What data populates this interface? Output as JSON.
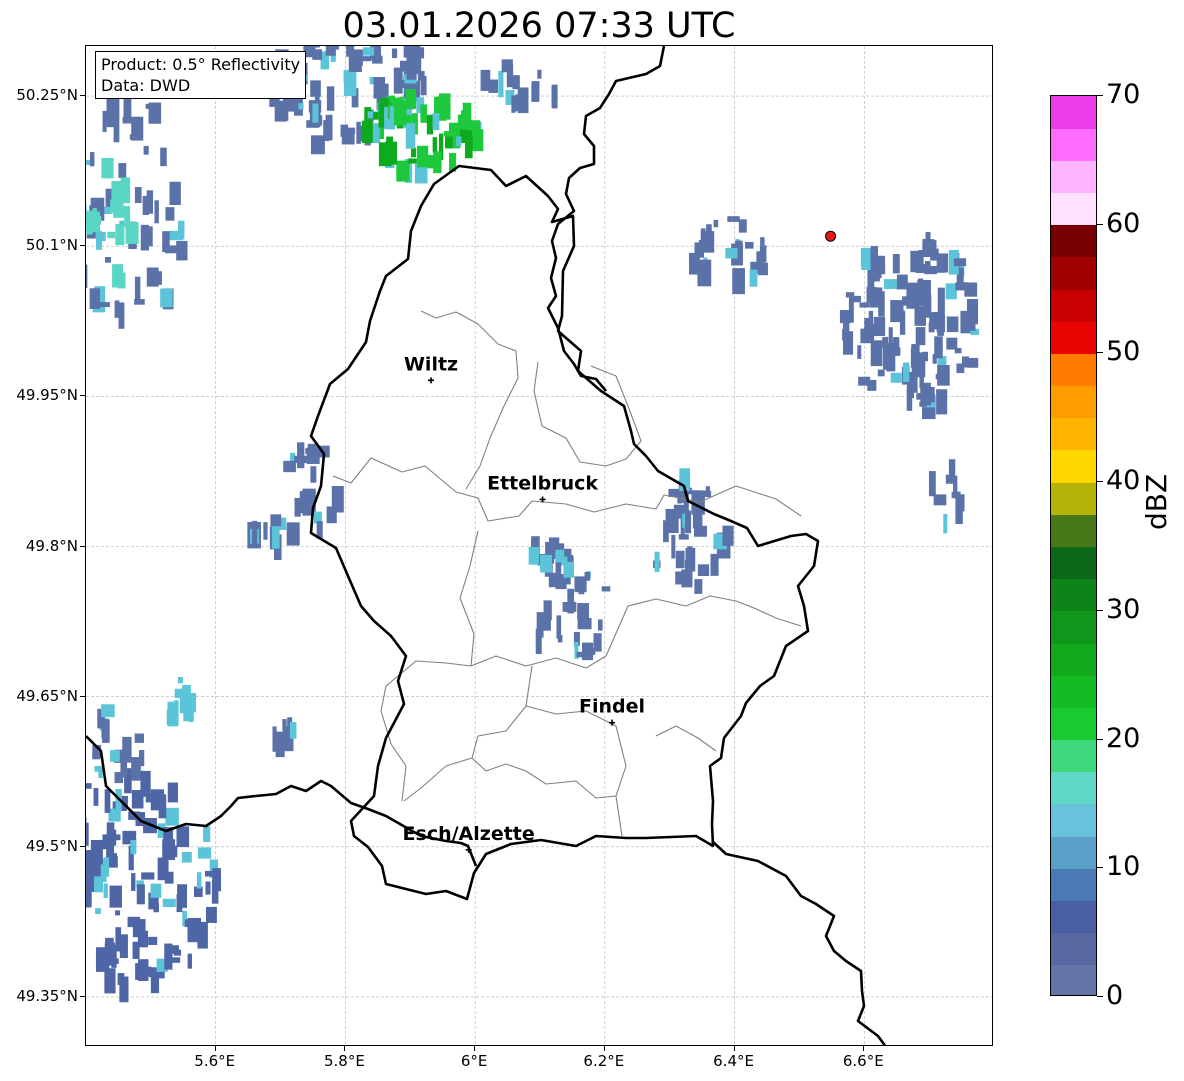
{
  "title": "03.01.2026 07:33 UTC",
  "info": {
    "product": "Product: 0.5° Reflectivity",
    "data_source": "Data: DWD"
  },
  "axes": {
    "lat_ticks": [
      {
        "value": 50.25,
        "label": "50.25°N"
      },
      {
        "value": 50.1,
        "label": "50.1°N"
      },
      {
        "value": 49.95,
        "label": "49.95°N"
      },
      {
        "value": 49.8,
        "label": "49.8°N"
      },
      {
        "value": 49.65,
        "label": "49.65°N"
      },
      {
        "value": 49.5,
        "label": "49.5°N"
      },
      {
        "value": 49.35,
        "label": "49.35°N"
      }
    ],
    "lon_ticks": [
      {
        "value": 5.6,
        "label": "5.6°E"
      },
      {
        "value": 5.8,
        "label": "5.8°E"
      },
      {
        "value": 6.0,
        "label": "6°E"
      },
      {
        "value": 6.2,
        "label": "6.2°E"
      },
      {
        "value": 6.4,
        "label": "6.4°E"
      },
      {
        "value": 6.6,
        "label": "6.6°E"
      }
    ],
    "lon_range": [
      5.4,
      6.8
    ],
    "lat_range": [
      49.3,
      50.3
    ],
    "grid": true
  },
  "cities": [
    {
      "name": "Wiltz",
      "lon": 5.932,
      "lat": 49.966
    },
    {
      "name": "Ettelbruck",
      "lon": 6.104,
      "lat": 49.847
    },
    {
      "name": "Findel",
      "lon": 6.211,
      "lat": 49.624
    },
    {
      "name": "Esch/Alzette",
      "lon": 5.99,
      "lat": 49.497
    }
  ],
  "radar_site": {
    "lon": 6.548,
    "lat": 50.11,
    "color": "#e31a1c"
  },
  "colorbar": {
    "label": "dBZ",
    "min": 0,
    "max": 70,
    "tick_labels": [
      "0",
      "10",
      "20",
      "30",
      "40",
      "50",
      "60",
      "70"
    ],
    "colors": [
      "#6474a6",
      "#5868a0",
      "#4a5fa2",
      "#4a7ab4",
      "#5aa0c8",
      "#68c2dc",
      "#60d8c8",
      "#40d87c",
      "#18cc30",
      "#14bc24",
      "#12a81c",
      "#10961a",
      "#0e8418",
      "#0b6818",
      "#487818",
      "#b4b408",
      "#ffd800",
      "#ffb400",
      "#ff9c00",
      "#ff7c00",
      "#e80400",
      "#c80000",
      "#a00000",
      "#780000",
      "#ffe0ff",
      "#ffb4ff",
      "#ff6cff",
      "#ec3cec"
    ]
  },
  "echo_colors": {
    "light": "#5a72a8",
    "medium": "#4f66a6",
    "cyan": "#5cc4d8",
    "teal": "#5ad6c4",
    "green": "#1ec83c",
    "green_dark": "#0eaa1e"
  }
}
